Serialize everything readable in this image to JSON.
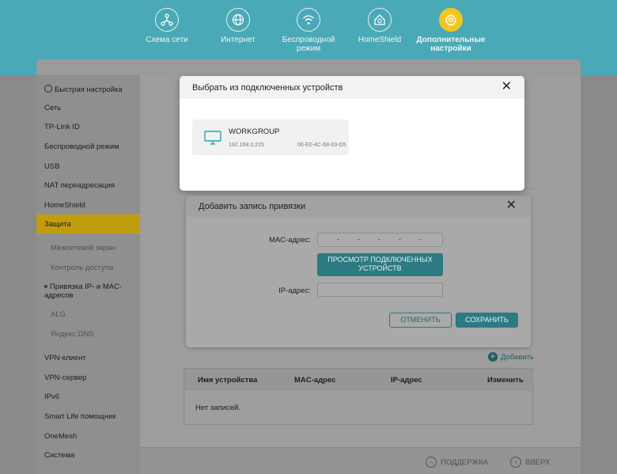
{
  "nav": [
    {
      "label": "Схема сети",
      "icon": "network-map-icon"
    },
    {
      "label": "Интернет",
      "icon": "globe-icon"
    },
    {
      "label": "Беспроводной режим",
      "icon": "wifi-icon"
    },
    {
      "label": "HomeShield",
      "icon": "home-shield-icon"
    },
    {
      "label": "Дополнительные настройки",
      "icon": "gear-icon",
      "active": true
    }
  ],
  "sidebar": {
    "items": [
      "Быстрая настройка",
      "Сеть",
      "TP-Link ID",
      "Беспроводной режим",
      "USB",
      "NAT переадресация",
      "HomeShield",
      "Защита"
    ],
    "sub_items": [
      "Межсетевой экран",
      "Контроль доступа",
      "Привязка IP- и MAC-адресов",
      "ALG",
      "Яндекс.DNS"
    ],
    "items_after": [
      "VPN-клиент",
      "VPN-сервер",
      "IPv6",
      "Smart Life помощник",
      "OneMesh",
      "Система"
    ]
  },
  "main": {
    "add_label": "Добавить",
    "table": {
      "headers": [
        "Имя устройства",
        "MAC-адрес",
        "IP-адрес",
        "Изменить"
      ],
      "empty": "Нет записей."
    }
  },
  "footer": {
    "support": "ПОДДЕРЖКА",
    "top": "ВВЕРХ"
  },
  "devices_modal": {
    "title": "Выбрать из подключенных устройств",
    "close": "✕",
    "devices": [
      {
        "name": "WORKGROUP",
        "ip": "192.168.0.215",
        "mac": "00-E0-4C-68-03-D5"
      }
    ]
  },
  "binding_modal": {
    "title": "Добавить запись привязки",
    "close": "✕",
    "mac_label": "MAC-адрес:",
    "mac_sep": "-",
    "view_button": "ПРОСМОТР ПОДКЛЮЧЕННЫХ УСТРОЙСТВ",
    "ip_label": "IP-адрес:",
    "cancel": "ОТМЕНИТЬ",
    "save": "СОХРАНИТЬ"
  },
  "colors": {
    "header": "#4aa9b6",
    "accent": "#f2c521",
    "button": "#2d7a82"
  }
}
